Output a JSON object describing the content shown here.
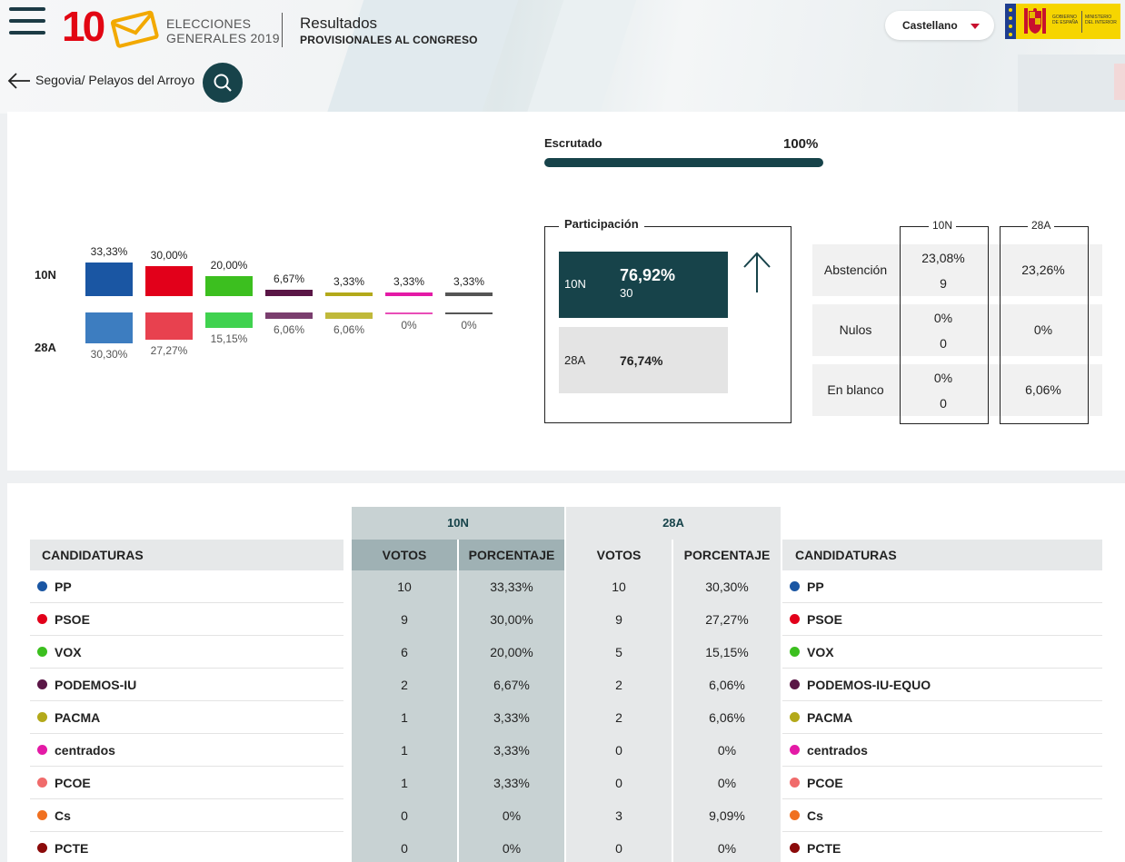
{
  "header": {
    "logo_number": "10",
    "logo_line1": "ELECCIONES",
    "logo_line2": "GENERALES 2019",
    "title": "Resultados",
    "subtitle": "PROVISIONALES AL CONGRESO",
    "language": "Castellano",
    "gov_text_1": [
      "GOBIERNO",
      "DE ESPAÑA"
    ],
    "gov_text_2": [
      "MINISTERIO",
      "DEL INTERIOR"
    ]
  },
  "nav": {
    "breadcrumb": "Segovia/ Pelayos del Arroyo"
  },
  "summary": {
    "row_labels": [
      "10N",
      "28A"
    ],
    "escrutado_label": "Escrutado",
    "escrutado_value": "100%",
    "escrutado_fraction": 1.0,
    "bars": [
      {
        "color_10n": "#1a56a3",
        "color_28a": "#3d7dc0",
        "pct_10n": "33,33%",
        "pct_28a": "30,30%",
        "v10n": 33.33,
        "v28a": 30.3
      },
      {
        "color_10n": "#e2001a",
        "color_28a": "#e8414f",
        "pct_10n": "30,00%",
        "pct_28a": "27,27%",
        "v10n": 30.0,
        "v28a": 27.27
      },
      {
        "color_10n": "#3cbf1f",
        "color_28a": "#40d24f",
        "pct_10n": "20,00%",
        "pct_28a": "15,15%",
        "v10n": 20.0,
        "v28a": 15.15
      },
      {
        "color_10n": "#5a1646",
        "color_28a": "#7a3e6e",
        "pct_10n": "6,67%",
        "pct_28a": "6,06%",
        "v10n": 6.67,
        "v28a": 6.06
      },
      {
        "color_10n": "#b3a91a",
        "color_28a": "#c0b93a",
        "pct_10n": "3,33%",
        "pct_28a": "6,06%",
        "v10n": 3.33,
        "v28a": 6.06
      },
      {
        "color_10n": "#e41aa6",
        "color_28a": "#e94db8",
        "pct_10n": "3,33%",
        "pct_28a": "0%",
        "v10n": 3.33,
        "v28a": 0
      },
      {
        "color_10n": "#555555",
        "color_28a": "#555555",
        "pct_10n": "3,33%",
        "pct_28a": "0%",
        "v10n": 3.33,
        "v28a": 0
      }
    ],
    "participacion": {
      "title": "Participación",
      "label_10n": "10N",
      "pct_10n": "76,92%",
      "count_10n": "30",
      "label_28a": "28A",
      "pct_28a": "76,74%",
      "trend": "up-arrow-icon"
    },
    "stats": {
      "col_10n": "10N",
      "col_28a": "28A",
      "rows": [
        {
          "label": "Abstención",
          "pct_10n": "23,08%",
          "count_10n": "9",
          "pct_28a": "23,26%"
        },
        {
          "label": "Nulos",
          "pct_10n": "0%",
          "count_10n": "0",
          "pct_28a": "0%"
        },
        {
          "label": "En blanco",
          "pct_10n": "0%",
          "count_10n": "0",
          "pct_28a": "6,06%"
        }
      ]
    }
  },
  "table": {
    "group_10n": "10N",
    "group_28a": "28A",
    "headers": {
      "candidaturas": "CANDIDATURAS",
      "votos": "VOTOS",
      "porcentaje": "PORCENTAJE"
    },
    "rows": [
      {
        "name_10n": "PP",
        "color": "#1a56a3",
        "votos_10n": "10",
        "pct_10n": "33,33%",
        "votos_28a": "10",
        "pct_28a": "30,30%",
        "name_28a": "PP"
      },
      {
        "name_10n": "PSOE",
        "color": "#e2001a",
        "votos_10n": "9",
        "pct_10n": "30,00%",
        "votos_28a": "9",
        "pct_28a": "27,27%",
        "name_28a": "PSOE"
      },
      {
        "name_10n": "VOX",
        "color": "#3cbf1f",
        "votos_10n": "6",
        "pct_10n": "20,00%",
        "votos_28a": "5",
        "pct_28a": "15,15%",
        "name_28a": "VOX"
      },
      {
        "name_10n": "PODEMOS-IU",
        "color": "#5a1646",
        "votos_10n": "2",
        "pct_10n": "6,67%",
        "votos_28a": "2",
        "pct_28a": "6,06%",
        "name_28a": "PODEMOS-IU-EQUO"
      },
      {
        "name_10n": "PACMA",
        "color": "#b3a91a",
        "votos_10n": "1",
        "pct_10n": "3,33%",
        "votos_28a": "2",
        "pct_28a": "6,06%",
        "name_28a": "PACMA"
      },
      {
        "name_10n": "centrados",
        "color": "#e41aa6",
        "votos_10n": "1",
        "pct_10n": "3,33%",
        "votos_28a": "0",
        "pct_28a": "0%",
        "name_28a": "centrados"
      },
      {
        "name_10n": "PCOE",
        "color": "#f06b6b",
        "votos_10n": "1",
        "pct_10n": "3,33%",
        "votos_28a": "0",
        "pct_28a": "0%",
        "name_28a": "PCOE"
      },
      {
        "name_10n": "Cs",
        "color": "#f07020",
        "votos_10n": "0",
        "pct_10n": "0%",
        "votos_28a": "3",
        "pct_28a": "9,09%",
        "name_28a": "Cs"
      },
      {
        "name_10n": "PCTE",
        "color": "#8b0a0a",
        "votos_10n": "0",
        "pct_10n": "0%",
        "votos_28a": "0",
        "pct_28a": "0%",
        "name_28a": "PCTE"
      }
    ]
  },
  "colors": {
    "accent": "#17434a",
    "brand_red": "#e20613",
    "col_10n_dark": "#9fb1b4",
    "col_10n_light": "#c8d2d3",
    "col_28a": "#e6e8e9"
  }
}
